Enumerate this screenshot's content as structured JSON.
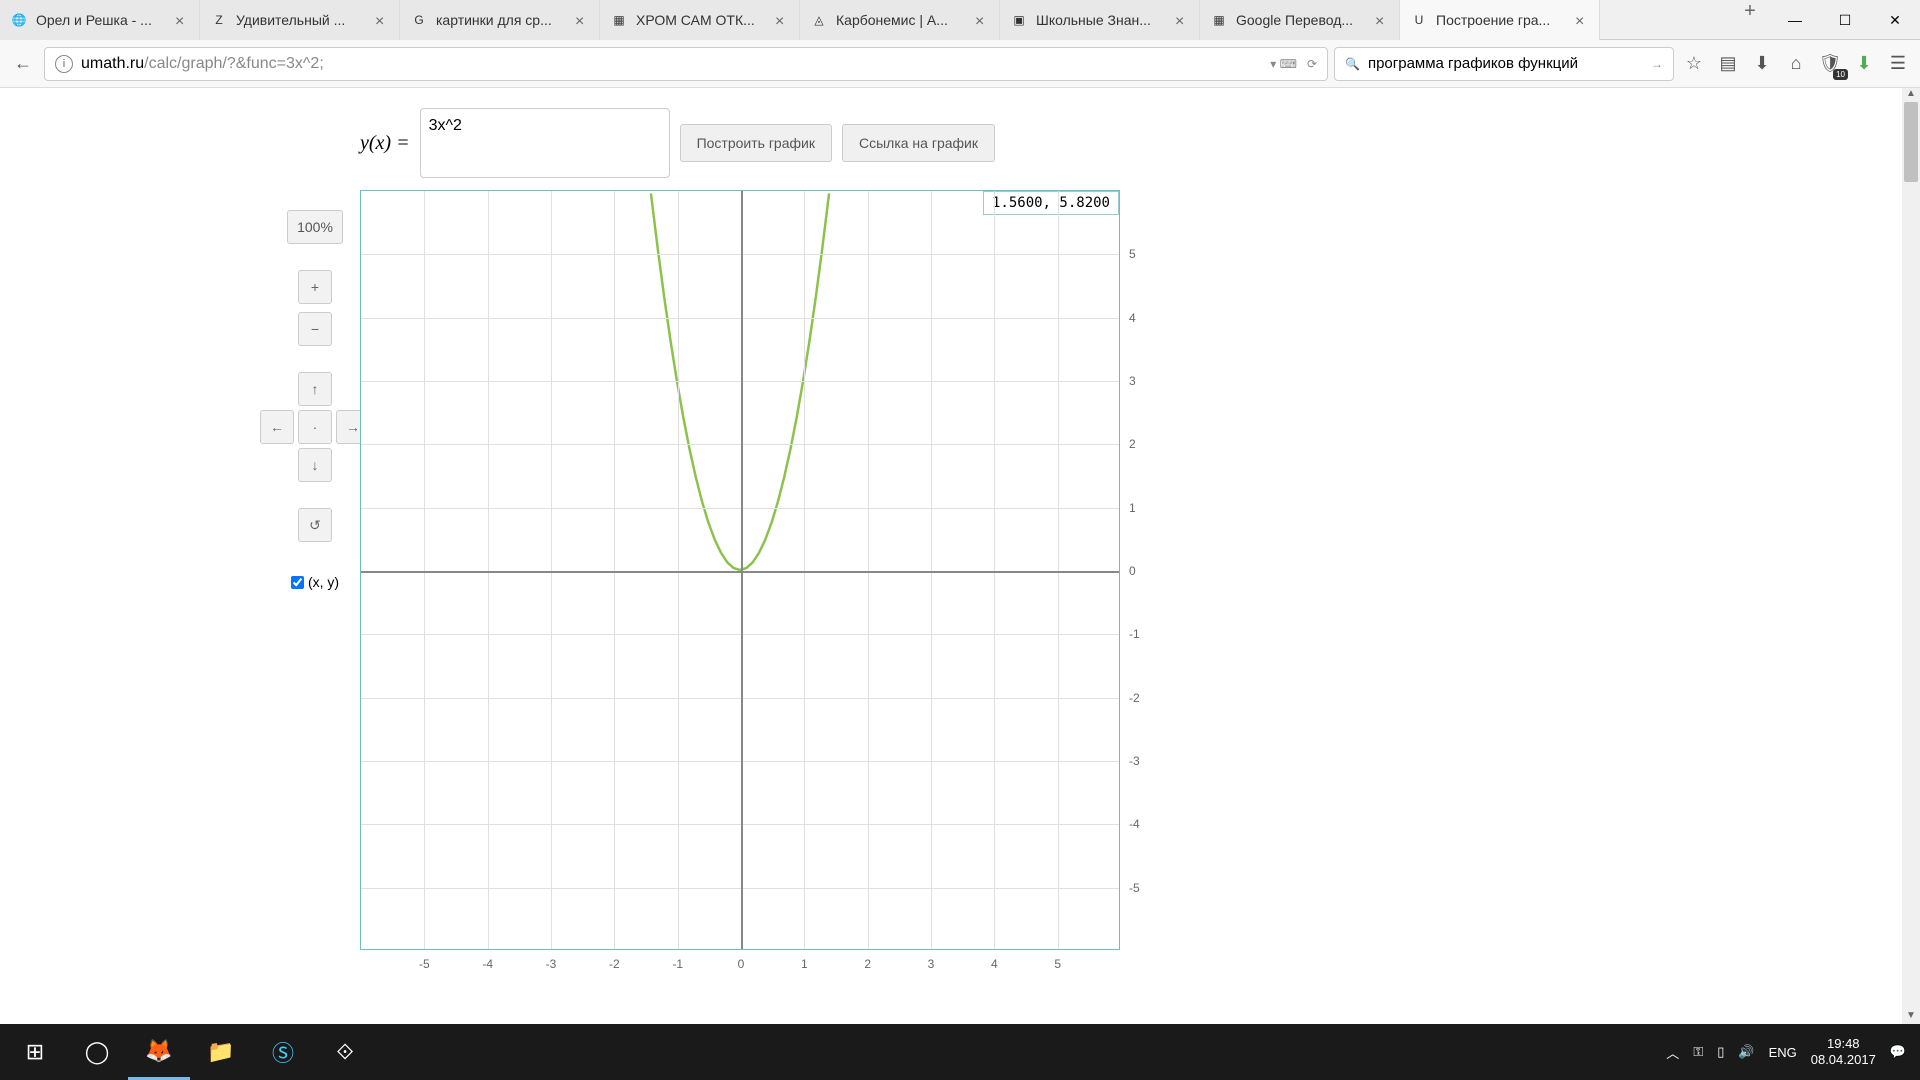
{
  "browser": {
    "tabs": [
      {
        "title": "Орел и Решка - ...",
        "icon": "🌐"
      },
      {
        "title": "Удивительный ...",
        "icon": "Z"
      },
      {
        "title": "картинки для ср...",
        "icon": "G"
      },
      {
        "title": "ХРОМ САМ ОТК...",
        "icon": "▦"
      },
      {
        "title": "Карбонемис | А...",
        "icon": "◬"
      },
      {
        "title": "Школьные Знан...",
        "icon": "▣"
      },
      {
        "title": "Google Перевод...",
        "icon": "▦"
      },
      {
        "title": "Построение гра...",
        "icon": "U"
      }
    ],
    "active_tab": 7,
    "url_host": "umath.ru",
    "url_path": "/calc/graph/?&func=3x^2;",
    "search_value": "программа графиков функций"
  },
  "app": {
    "formula_prefix": "y(x) =",
    "function_input": "3x^2",
    "btn_plot": "Построить график",
    "btn_link": "Ссылка на график",
    "zoom": "100%",
    "zoom_in": "+",
    "zoom_out": "−",
    "arrow_up": "↑",
    "arrow_down": "↓",
    "arrow_left": "←",
    "arrow_right": "→",
    "arrow_center": "·",
    "reset": "↺",
    "xy_label": "(x, y)",
    "cursor_readout": "1.5600, 5.8200"
  },
  "chart_data": {
    "type": "line",
    "title": "",
    "xlabel": "",
    "ylabel": "",
    "xlim": [
      -6,
      6
    ],
    "ylim": [
      -6,
      6
    ],
    "x_ticks": [
      -5,
      -4,
      -3,
      -2,
      -1,
      0,
      1,
      2,
      3,
      4,
      5
    ],
    "y_ticks": [
      -5,
      -4,
      -3,
      -2,
      -1,
      0,
      1,
      2,
      3,
      4,
      5
    ],
    "series": [
      {
        "name": "3x^2",
        "color": "#8bc34a",
        "x": [
          -1.41,
          -1.3,
          -1.2,
          -1.1,
          -1.0,
          -0.9,
          -0.8,
          -0.7,
          -0.6,
          -0.5,
          -0.4,
          -0.3,
          -0.2,
          -0.1,
          0,
          0.1,
          0.2,
          0.3,
          0.4,
          0.5,
          0.6,
          0.7,
          0.8,
          0.9,
          1.0,
          1.1,
          1.2,
          1.3,
          1.41
        ],
        "y": [
          5.96,
          5.07,
          4.32,
          3.63,
          3.0,
          2.43,
          1.92,
          1.47,
          1.08,
          0.75,
          0.48,
          0.27,
          0.12,
          0.03,
          0,
          0.03,
          0.12,
          0.27,
          0.48,
          0.75,
          1.08,
          1.47,
          1.92,
          2.43,
          3.0,
          3.63,
          4.32,
          5.07,
          5.96
        ]
      }
    ]
  },
  "taskbar": {
    "lang": "ENG",
    "time": "19:48",
    "date": "08.04.2017"
  }
}
